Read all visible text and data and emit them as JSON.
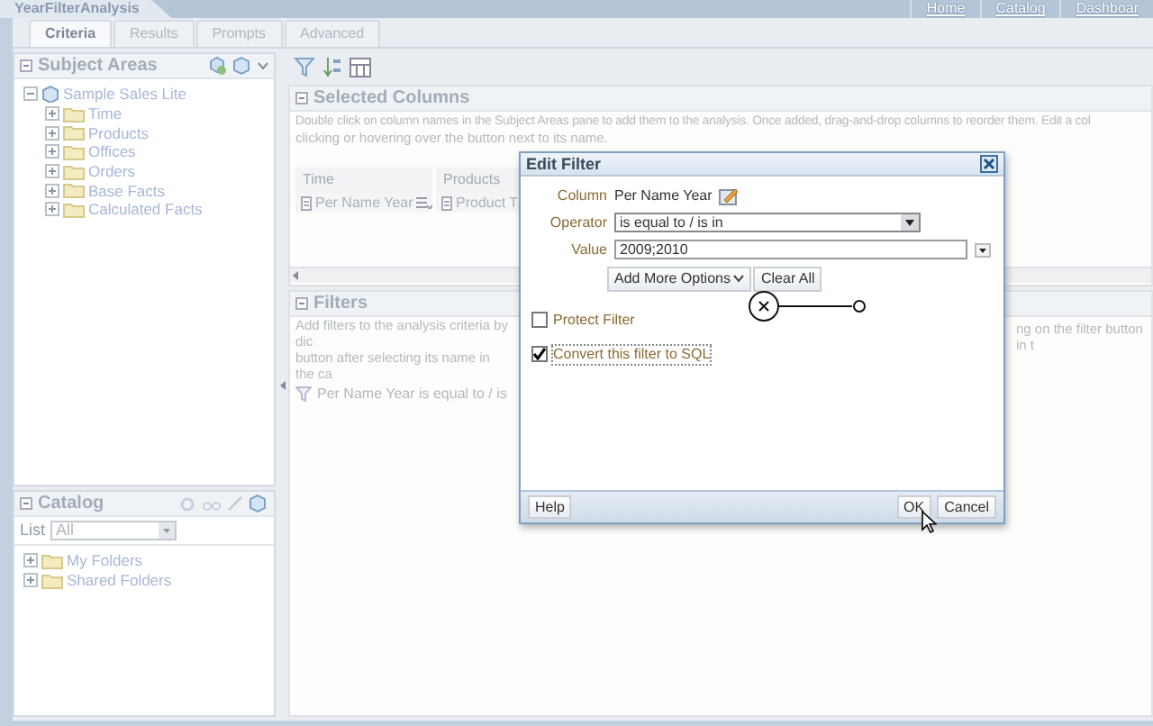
{
  "header": {
    "title": "YearFilterAnalysis",
    "links": [
      "Home",
      "Catalog",
      "Dashboar"
    ]
  },
  "tabs": [
    {
      "label": "Criteria",
      "selected": true
    },
    {
      "label": "Results",
      "selected": false
    },
    {
      "label": "Prompts",
      "selected": false
    },
    {
      "label": "Advanced",
      "selected": false
    }
  ],
  "subject_areas": {
    "title": "Subject Areas",
    "root": {
      "label": "Sample Sales Lite",
      "expanded": true,
      "children": [
        {
          "label": "Time",
          "expanded": false
        },
        {
          "label": "Products",
          "expanded": false
        },
        {
          "label": "Offices",
          "expanded": false
        },
        {
          "label": "Orders",
          "expanded": false
        },
        {
          "label": "Base Facts",
          "expanded": false
        },
        {
          "label": "Calculated Facts",
          "expanded": false
        }
      ]
    }
  },
  "catalog": {
    "title": "Catalog",
    "list_label": "List",
    "list_value": "All",
    "folders": [
      {
        "label": "My Folders",
        "expanded": false
      },
      {
        "label": "Shared Folders",
        "expanded": false
      }
    ]
  },
  "selected_columns": {
    "title": "Selected Columns",
    "description": "Double click on column names in the Subject Areas pane to add them to the analysis. Once added, drag-and-drop columns to reorder them. Edit a col",
    "description_2": "clicking or hovering over the button next to its name.",
    "columns": [
      {
        "heading": "Time",
        "cell": "Per Name Year"
      },
      {
        "heading": "Products",
        "cell": "Product T"
      }
    ]
  },
  "filters": {
    "title": "Filters",
    "description_left": [
      "Add filters to the analysis criteria by dic",
      "button after selecting its name in the ca"
    ],
    "description_right": "ng on the filter button in t",
    "item": "Per Name Year is equal to / is"
  },
  "dialog": {
    "title": "Edit Filter",
    "column_label": "Column",
    "column_value": "Per Name Year",
    "operator_label": "Operator",
    "operator_value": "is equal to / is in",
    "value_label": "Value",
    "value": "2009;2010",
    "buttons": [
      "Add More Options",
      "Clear All"
    ],
    "checkboxes": [
      {
        "label": "Protect Filter",
        "checked": false
      },
      {
        "label": "Convert this filter to SQL",
        "checked": true
      }
    ],
    "footer_left": "Help",
    "footer_right": [
      "OK",
      "Cancel"
    ]
  }
}
